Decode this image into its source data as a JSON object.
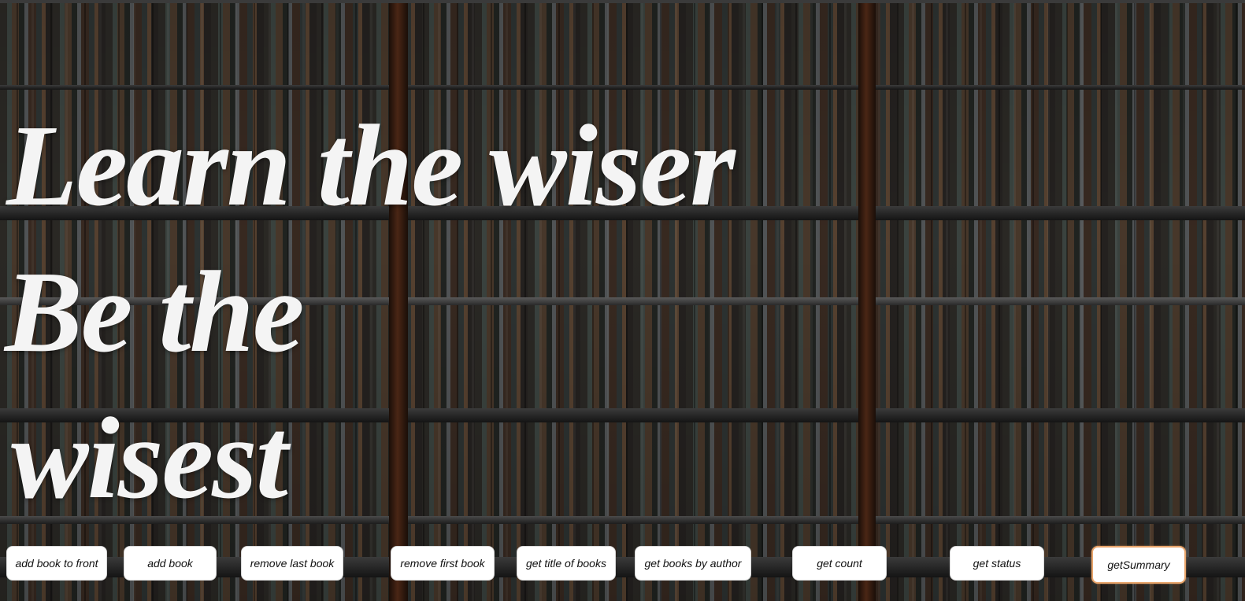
{
  "hero": {
    "line1": "Learn the wiser",
    "line2": "Be the",
    "line3": "wisest"
  },
  "actions": {
    "add_book_to_front": "add book to front",
    "add_book": "add book",
    "remove_last_book": "remove last book",
    "remove_first_book": "remove first book",
    "get_title_of_books": "get title of books",
    "get_books_by_author": "get books by author",
    "get_count": "get count",
    "get_status": "get status",
    "get_summary": "getSummary"
  },
  "colors": {
    "text_light": "#f4f4f4",
    "button_bg": "#ffffff",
    "focused_button_border": "#e8a46a",
    "shelf_wood": "#4a2615"
  },
  "background": {
    "icon": "bookshelf-photo"
  }
}
